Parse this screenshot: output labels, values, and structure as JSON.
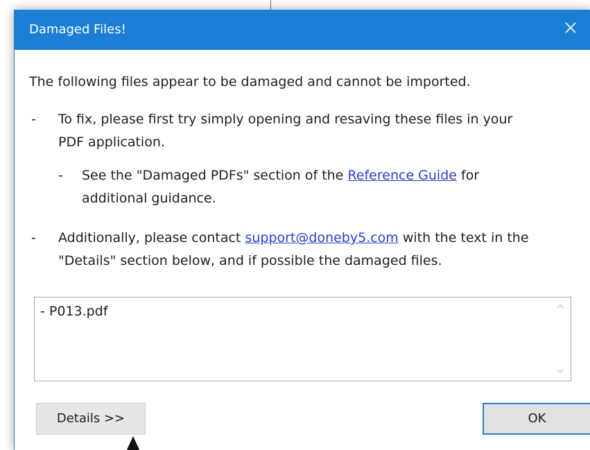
{
  "dialog": {
    "title": "Damaged Files!",
    "intro": "The following files appear to be damaged and cannot be imported.",
    "bullet1_line1": "To fix, please first try simply opening and resaving these files in your",
    "bullet1_line2": "PDF application.",
    "sub_prefix": "See the \"Damaged PDFs\" section of the ",
    "sub_link": "Reference Guide",
    "sub_suffix": " for",
    "sub_line2": "additional guidance.",
    "bullet2_prefix": "Additionally, please contact ",
    "bullet2_link": "support@doneby5.com",
    "bullet2_suffix": " with the text in the",
    "bullet2_line2": "\"Details\" section below, and if possible the damaged files.",
    "dash": "-",
    "details_content": "- P013.pdf",
    "details_button": "Details >>",
    "ok_button": "OK"
  },
  "colors": {
    "titlebar": "#1b7fd6",
    "link": "#2b3ecf",
    "focus_border": "#2a7bd3"
  },
  "icons": {
    "close": "close-icon",
    "scroll_up": "chevron-up-icon",
    "scroll_down": "chevron-down-icon",
    "cursor": "mouse-pointer-icon"
  }
}
